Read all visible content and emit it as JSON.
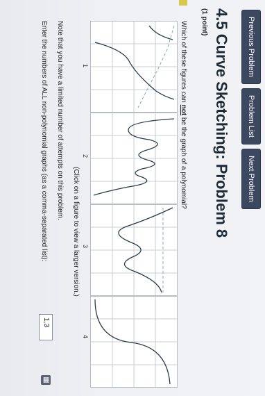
{
  "nav": {
    "previous": "Previous Problem",
    "list": "Problem List",
    "next": "Next Problem"
  },
  "title": "4.5 Curve Sketching: Problem 8",
  "points": "(1 point)",
  "question": {
    "prefix": "Which of these figures can ",
    "emph": "not",
    "suffix": " be the graph of a polynomial?"
  },
  "figures": [
    "1",
    "2",
    "3",
    "4"
  ],
  "click_note": "(Click on a figure to view a larger version.)",
  "limit_note": "Note that you have a limited number of attempts on this problem.",
  "enter_prompt": "Enter the numbers of ALL non-polynomial graphs (as a comma-separated list):",
  "answer_value": "1,3",
  "colors": {
    "button": "#3c4860",
    "curve": "#2b3a4a"
  }
}
